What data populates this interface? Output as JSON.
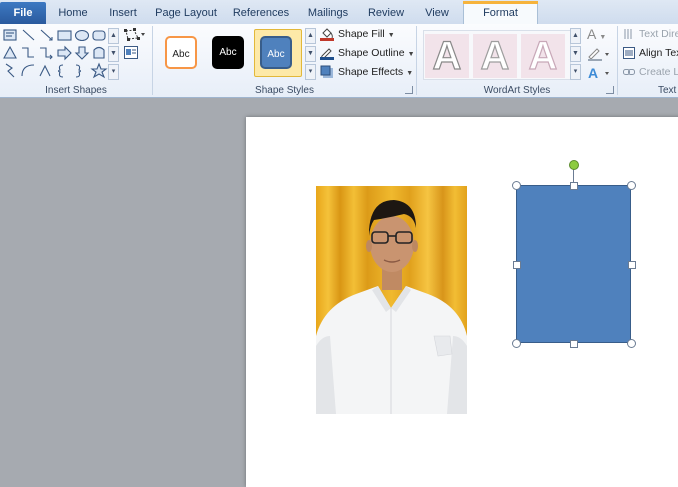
{
  "tabs": [
    "File",
    "Home",
    "Insert",
    "Page Layout",
    "References",
    "Mailings",
    "Review",
    "View",
    "Format"
  ],
  "groups": {
    "insert_shapes": "Insert Shapes",
    "shape_styles": "Shape Styles",
    "wordart_styles": "WordArt Styles",
    "text": "Text"
  },
  "shape_styles": {
    "swatch_label": "Abc",
    "shape_fill": "Shape Fill",
    "shape_outline": "Shape Outline",
    "shape_effects": "Shape Effects",
    "colors": {
      "fill": "#4f81bd",
      "outline_orange": "#f79646",
      "black": "#000000"
    }
  },
  "wordart": {
    "letter": "A"
  },
  "text_group": {
    "text_direction": "Text Dire",
    "align_text": "Align Tex",
    "create_link": "Create Li"
  },
  "document": {
    "selected_shape_fill": "#4f81bd"
  }
}
